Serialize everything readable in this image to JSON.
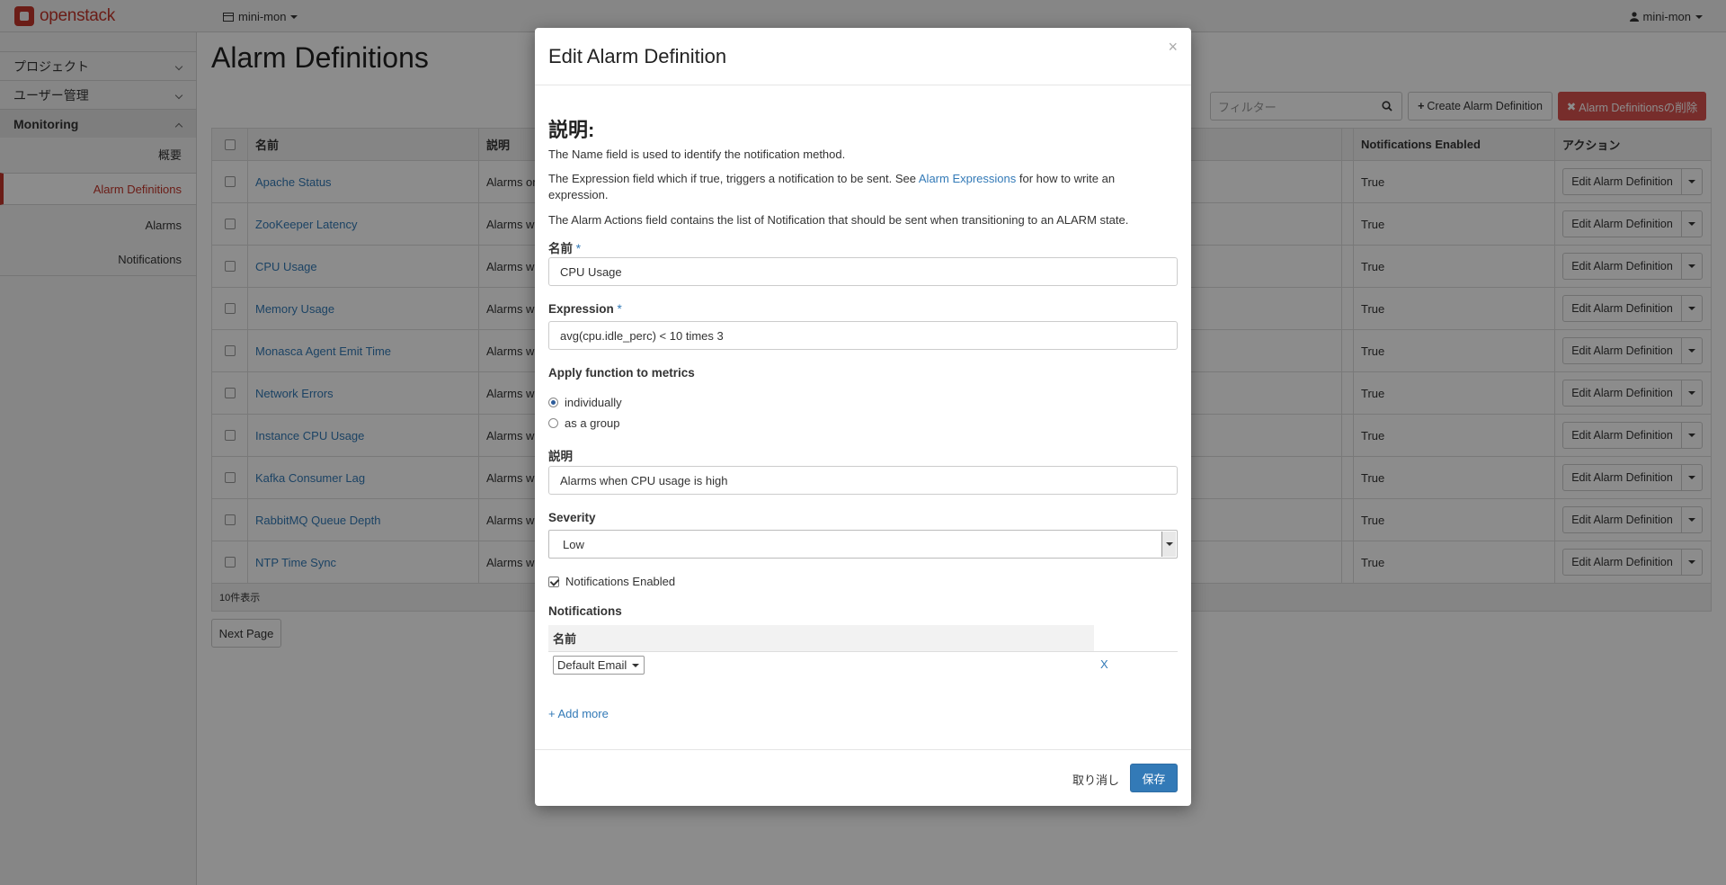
{
  "header": {
    "logo_text": "openstack",
    "project": "mini-mon",
    "user": "mini-mon"
  },
  "sidebar": {
    "sections": [
      {
        "label": "プロジェクト"
      },
      {
        "label": "ユーザー管理"
      },
      {
        "label": "Monitoring"
      }
    ],
    "items": [
      {
        "label": "概要"
      },
      {
        "label": "Alarm Definitions"
      },
      {
        "label": "Alarms"
      },
      {
        "label": "Notifications"
      }
    ]
  },
  "main": {
    "title": "Alarm Definitions",
    "filter_placeholder": "フィルター",
    "create_label": "Create Alarm Definition",
    "delete_label": "Alarm Definitionsの削除",
    "columns": {
      "name": "名前",
      "description": "説明",
      "notifications_enabled": "Notifications Enabled",
      "actions": "アクション"
    },
    "rows": [
      {
        "name": "Apache Status",
        "desc": "Alarms on",
        "enabled": "True",
        "action": "Edit Alarm Definition"
      },
      {
        "name": "ZooKeeper Latency",
        "desc": "Alarms w",
        "enabled": "True",
        "action": "Edit Alarm Definition"
      },
      {
        "name": "CPU Usage",
        "desc": "Alarms w",
        "enabled": "True",
        "action": "Edit Alarm Definition"
      },
      {
        "name": "Memory Usage",
        "desc": "Alarms w",
        "enabled": "True",
        "action": "Edit Alarm Definition"
      },
      {
        "name": "Monasca Agent Emit Time",
        "desc": "Alarms w",
        "enabled": "True",
        "action": "Edit Alarm Definition"
      },
      {
        "name": "Network Errors",
        "desc": "Alarms w",
        "enabled": "True",
        "action": "Edit Alarm Definition"
      },
      {
        "name": "Instance CPU Usage",
        "desc": "Alarms w",
        "enabled": "True",
        "action": "Edit Alarm Definition"
      },
      {
        "name": "Kafka Consumer Lag",
        "desc": "Alarms w",
        "enabled": "True",
        "action": "Edit Alarm Definition"
      },
      {
        "name": "RabbitMQ Queue Depth",
        "desc": "Alarms w",
        "enabled": "True",
        "action": "Edit Alarm Definition"
      },
      {
        "name": "NTP Time Sync",
        "desc": "Alarms w",
        "enabled": "True",
        "action": "Edit Alarm Definition"
      }
    ],
    "footer_count": "10件表示",
    "next_page": "Next Page"
  },
  "modal": {
    "title": "Edit Alarm Definition",
    "close": "×",
    "help_title": "説明:",
    "help_1": "The Name field is used to identify the notification method.",
    "help_2_pre": "The Expression field which if true, triggers a notification to be sent. See ",
    "help_2_link": "Alarm Expressions",
    "help_2_post": " for how to write an expression.",
    "help_3": "The Alarm Actions field contains the list of Notification that should be sent when transitioning to an ALARM state.",
    "name_label": "名前",
    "name_value": "CPU Usage",
    "expression_label": "Expression",
    "expression_value": "avg(cpu.idle_perc) < 10 times 3",
    "required_mark": "*",
    "apply_label": "Apply function to metrics",
    "apply_options": [
      "individually",
      "as a group"
    ],
    "description_label": "説明",
    "description_value": "Alarms when CPU usage is high",
    "severity_label": "Severity",
    "severity_value": "Low",
    "notifications_enabled_label": "Notifications Enabled",
    "notifications_label": "Notifications",
    "notifications_col": "名前",
    "notification_value": "Default Email",
    "remove_label": "X",
    "add_more": "+ Add more",
    "cancel": "取り消し",
    "save": "保存"
  }
}
